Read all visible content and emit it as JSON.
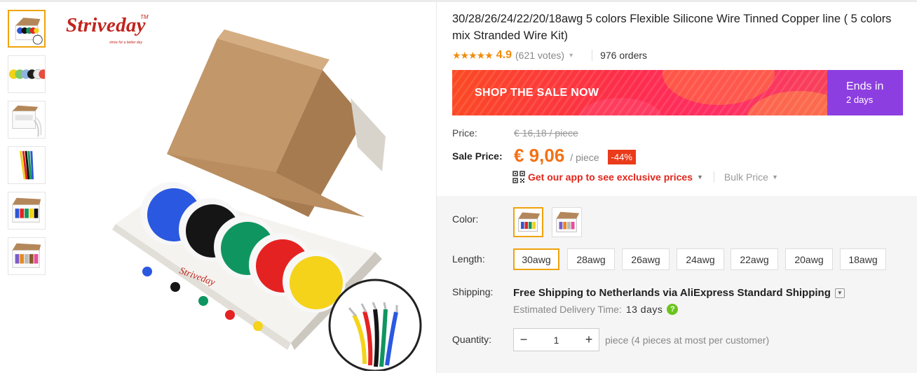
{
  "thumbnails": [
    {
      "alt": "wire-box-5-colors"
    },
    {
      "alt": "wire-spools-row"
    },
    {
      "alt": "wire-box-white-cables"
    },
    {
      "alt": "wire-strands-closeup"
    },
    {
      "alt": "wire-box-1"
    },
    {
      "alt": "wire-box-2"
    }
  ],
  "brand": {
    "name": "Striveday",
    "tm": "TM",
    "tagline": "strive for a better day"
  },
  "product": {
    "title": "30/28/26/24/22/20/18awg 5 colors Flexible Silicone Wire Tinned Copper line ( 5 colors mix Stranded Wire Kit)",
    "stars": "★★★★★",
    "rating": "4.9",
    "votes": "(621 votes)",
    "orders": "976 orders"
  },
  "sale": {
    "cta": "SHOP THE SALE NOW",
    "ends_label": "Ends in",
    "ends_value": "2 days",
    "colors": {
      "left": "#fd2d4a",
      "right": "#8d3ee0"
    }
  },
  "price": {
    "label": "Price:",
    "original": "€ 16,18 / piece",
    "sale_label": "Sale Price:",
    "sale_price": "€ 9,06",
    "per_piece": "/ piece",
    "discount": "-44%",
    "app_text": "Get our app to see exclusive prices",
    "bulk_text": "Bulk Price",
    "accent": "#f47115"
  },
  "options": {
    "color_label": "Color:",
    "colors": [
      {
        "name": "Box 1",
        "selected": true
      },
      {
        "name": "Box 2",
        "selected": false
      }
    ],
    "length_label": "Length:",
    "lengths": [
      {
        "label": "30awg",
        "selected": true
      },
      {
        "label": "28awg",
        "selected": false
      },
      {
        "label": "26awg",
        "selected": false
      },
      {
        "label": "24awg",
        "selected": false
      },
      {
        "label": "22awg",
        "selected": false
      },
      {
        "label": "20awg",
        "selected": false
      },
      {
        "label": "18awg",
        "selected": false
      }
    ]
  },
  "shipping": {
    "label": "Shipping:",
    "main": "Free Shipping to Netherlands via AliExpress Standard Shipping",
    "eta_label": "Estimated Delivery Time:",
    "eta_value": "13 days"
  },
  "quantity": {
    "label": "Quantity:",
    "value": "1",
    "minus": "−",
    "plus": "+",
    "note": "piece (4 pieces at most per customer)"
  }
}
